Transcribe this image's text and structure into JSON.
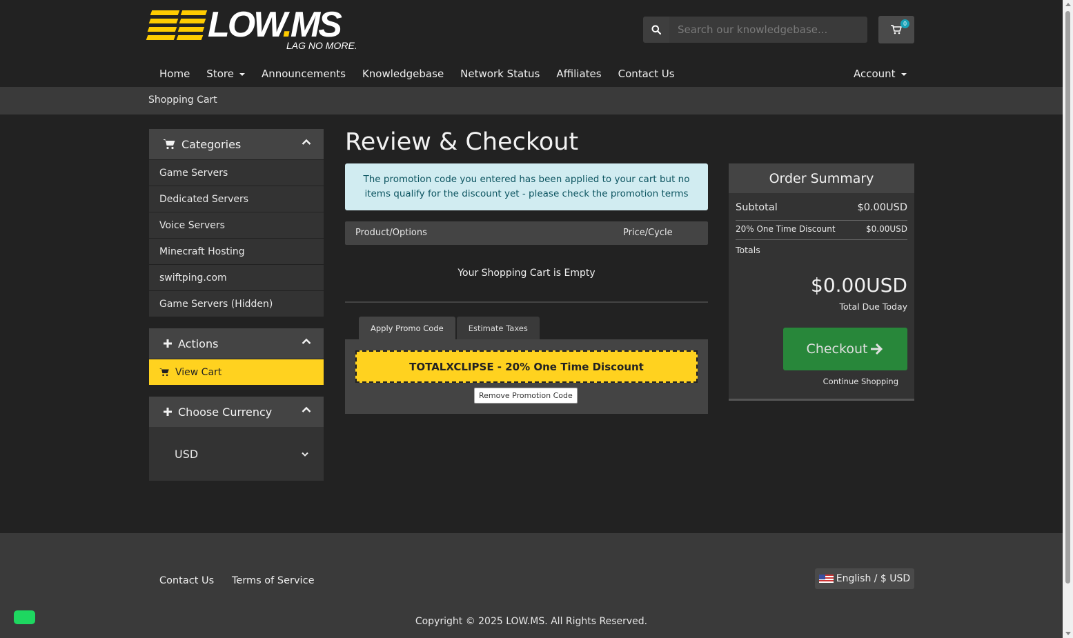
{
  "brand": {
    "name_part1": "LOW",
    "name_dot": ".",
    "name_part2": "MS",
    "tagline": "LAG NO MORE."
  },
  "search": {
    "placeholder": "Search our knowledgebase..."
  },
  "cart": {
    "count": "0"
  },
  "nav": {
    "home": "Home",
    "store": "Store",
    "announcements": "Announcements",
    "knowledgebase": "Knowledgebase",
    "network_status": "Network Status",
    "affiliates": "Affiliates",
    "contact_us": "Contact Us",
    "account": "Account"
  },
  "breadcrumb": "Shopping Cart",
  "sidebar": {
    "categories_title": "Categories",
    "categories": [
      "Game Servers",
      "Dedicated Servers",
      "Voice Servers",
      "Minecraft Hosting",
      "swiftping.com",
      "Game Servers (Hidden)"
    ],
    "actions_title": "Actions",
    "view_cart": "View Cart",
    "currency_title": "Choose Currency",
    "currency_selected": "USD"
  },
  "main": {
    "title": "Review & Checkout",
    "alert": "The promotion code you entered has been applied to your cart but no items qualify for the discount yet - please check the promotion terms",
    "col_product": "Product/Options",
    "col_price": "Price/Cycle",
    "empty": "Your Shopping Cart is Empty",
    "tab_promo": "Apply Promo Code",
    "tab_taxes": "Estimate Taxes",
    "promo_applied": "TOTALXCLIPSE - 20% One Time Discount",
    "remove_promo": "Remove Promotion Code"
  },
  "summary": {
    "title": "Order Summary",
    "subtotal_label": "Subtotal",
    "subtotal_value": "$0.00USD",
    "discount_label": "20% One Time Discount",
    "discount_value": "$0.00USD",
    "totals_label": "Totals",
    "total_amount": "$0.00USD",
    "total_due_label": "Total Due Today",
    "checkout": "Checkout",
    "continue": "Continue Shopping"
  },
  "footer": {
    "contact": "Contact Us",
    "terms": "Terms of Service",
    "language": "English / $ USD",
    "copyright": "Copyright © 2025 LOW.MS. All Rights Reserved."
  },
  "colors": {
    "accent": "#ffd21f",
    "checkout": "#28873a",
    "alert_bg": "#d1ecf1",
    "badge": "#17a2b8"
  }
}
